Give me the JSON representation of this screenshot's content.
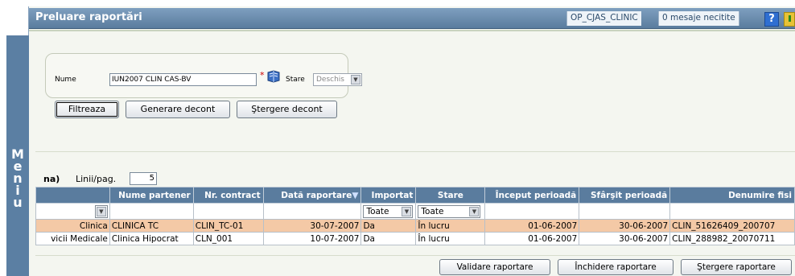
{
  "window": {
    "title": "Preluare raportări",
    "user": "OP_CJAS_CLINIC",
    "messages": "0 mesaje necitite"
  },
  "menu": {
    "letters": "M\ne\nn\ni\nu"
  },
  "filter": {
    "name_label": "Nume",
    "name_value": "IUN2007 CLIN CAS-BV",
    "required_mark": "*",
    "state_label": "Stare",
    "state_value": "Deschis",
    "buttons": {
      "filter": "Filtreaza",
      "generate": "Generare decont",
      "delete": "Ştergere decont"
    }
  },
  "pager": {
    "prefix": "na)",
    "rows_label": "Linii/pag.",
    "rows_value": "5"
  },
  "table": {
    "headers": [
      "",
      "Nume partener",
      "Nr. contract",
      "Dată raportare",
      "Importat",
      "Stare",
      "Început perioadă",
      "Sfârşit perioadă",
      "Denumire fisi"
    ],
    "sort_indicator": "▼",
    "filter_row": {
      "importat": "Toate",
      "stare": "Toate"
    },
    "rows": [
      [
        "Clinica",
        "CLINICA TC",
        "CLIN_TC-01",
        "30-07-2007",
        "Da",
        "În lucru",
        "01-06-2007",
        "30-06-2007",
        "CLIN_51626409_200707"
      ],
      [
        "vicii Medicale",
        "Clinica Hipocrat",
        "CLN_001",
        "10-07-2007",
        "Da",
        "În lucru",
        "01-06-2007",
        "30-06-2007",
        "CLIN_288982_20070711"
      ]
    ]
  },
  "actions": {
    "validate": "Validare raportare",
    "close": "Închidere raportare",
    "delete": "Ştergere raportare"
  },
  "colors": {
    "title_bar": "#5a7c9e",
    "menu_bar": "#5b7fa3",
    "selected_row": "#f4c9a6"
  }
}
